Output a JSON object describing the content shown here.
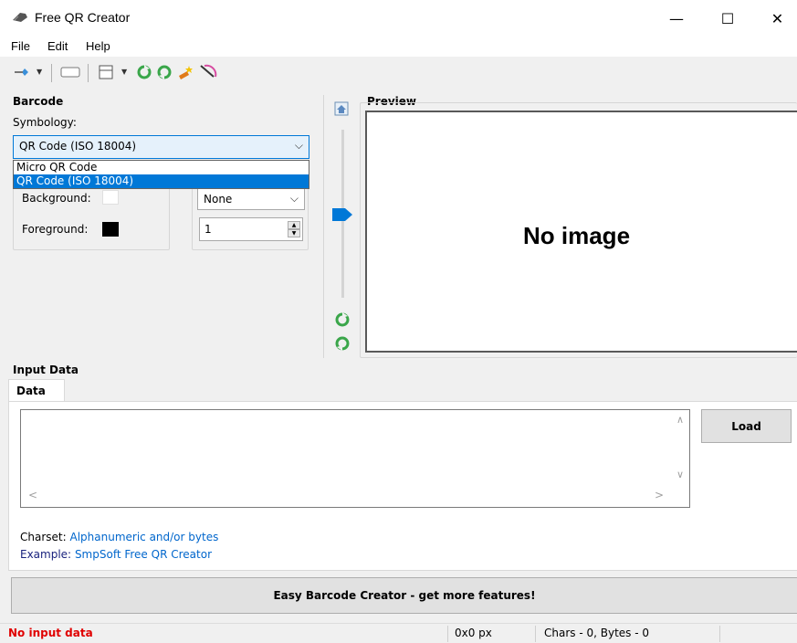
{
  "window": {
    "title": "Free QR Creator",
    "minimize_glyph": "—",
    "maximize_glyph": "☐",
    "close_glyph": "✕"
  },
  "menu": [
    "File",
    "Edit",
    "Help"
  ],
  "toolbar": {
    "icons": [
      "pin-icon",
      "dropdown-caret-icon",
      "label-icon",
      "grid-icon",
      "dropdown-caret-icon",
      "rotate-left-icon",
      "rotate-right-icon",
      "magic-wand-icon",
      "clear-icon"
    ]
  },
  "barcode": {
    "group_title": "Barcode",
    "symbology_label": "Symbology:",
    "symbology_value": "QR Code (ISO 18004)",
    "options": [
      "Micro QR Code",
      "QR Code (ISO 18004)"
    ],
    "selected_option_index": 1,
    "background_label": "Background:",
    "foreground_label": "Foreground:",
    "background_color": "#ffffff",
    "foreground_color": "#000000",
    "combo2_value": "None",
    "spin_value": "1"
  },
  "preview": {
    "group_title": "Preview",
    "no_image_text": "No image"
  },
  "input": {
    "group_title": "Input Data",
    "tab_label": "Data",
    "text_value": "",
    "load_button": "Load",
    "charset_label": "Charset:",
    "charset_value": "Alphanumeric and/or bytes",
    "example_label": "Example:",
    "example_value": "SmpSoft Free QR Creator"
  },
  "promo_button": "Easy Barcode Creator - get more features!",
  "status": {
    "message": "No input data",
    "size": "0x0 px",
    "counts": "Chars - 0, Bytes - 0"
  },
  "colors": {
    "accent": "#0078d7",
    "status_error": "#e00000",
    "link": "#0066cc"
  }
}
